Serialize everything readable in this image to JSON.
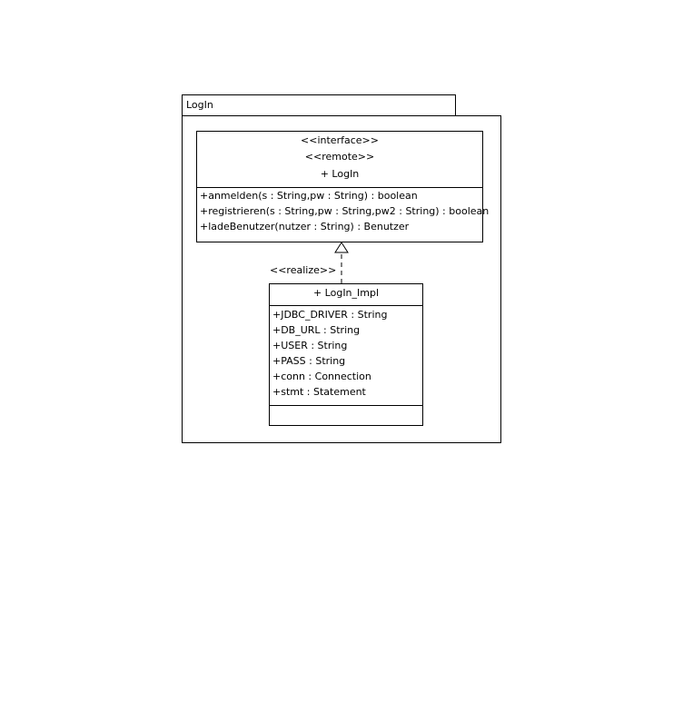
{
  "package": {
    "name": "LogIn"
  },
  "interface_class": {
    "stereotypes": [
      "<<interface>>",
      "<<remote>>"
    ],
    "name": "+ LogIn",
    "attributes": [],
    "operations": [
      "+anmelden(s : String,pw : String) : boolean",
      "+registrieren(s : String,pw : String,pw2 : String) : boolean",
      "+ladeBenutzer(nutzer : String) : Benutzer"
    ]
  },
  "impl_class": {
    "name": "+ LogIn_Impl",
    "attributes": [
      "+JDBC_DRIVER : String",
      "+DB_URL : String",
      "+USER : String",
      "+PASS : String",
      "+conn : Connection",
      "+stmt : Statement"
    ],
    "operations": []
  },
  "relationship": {
    "type": "realization",
    "label": "<<realize>>"
  }
}
